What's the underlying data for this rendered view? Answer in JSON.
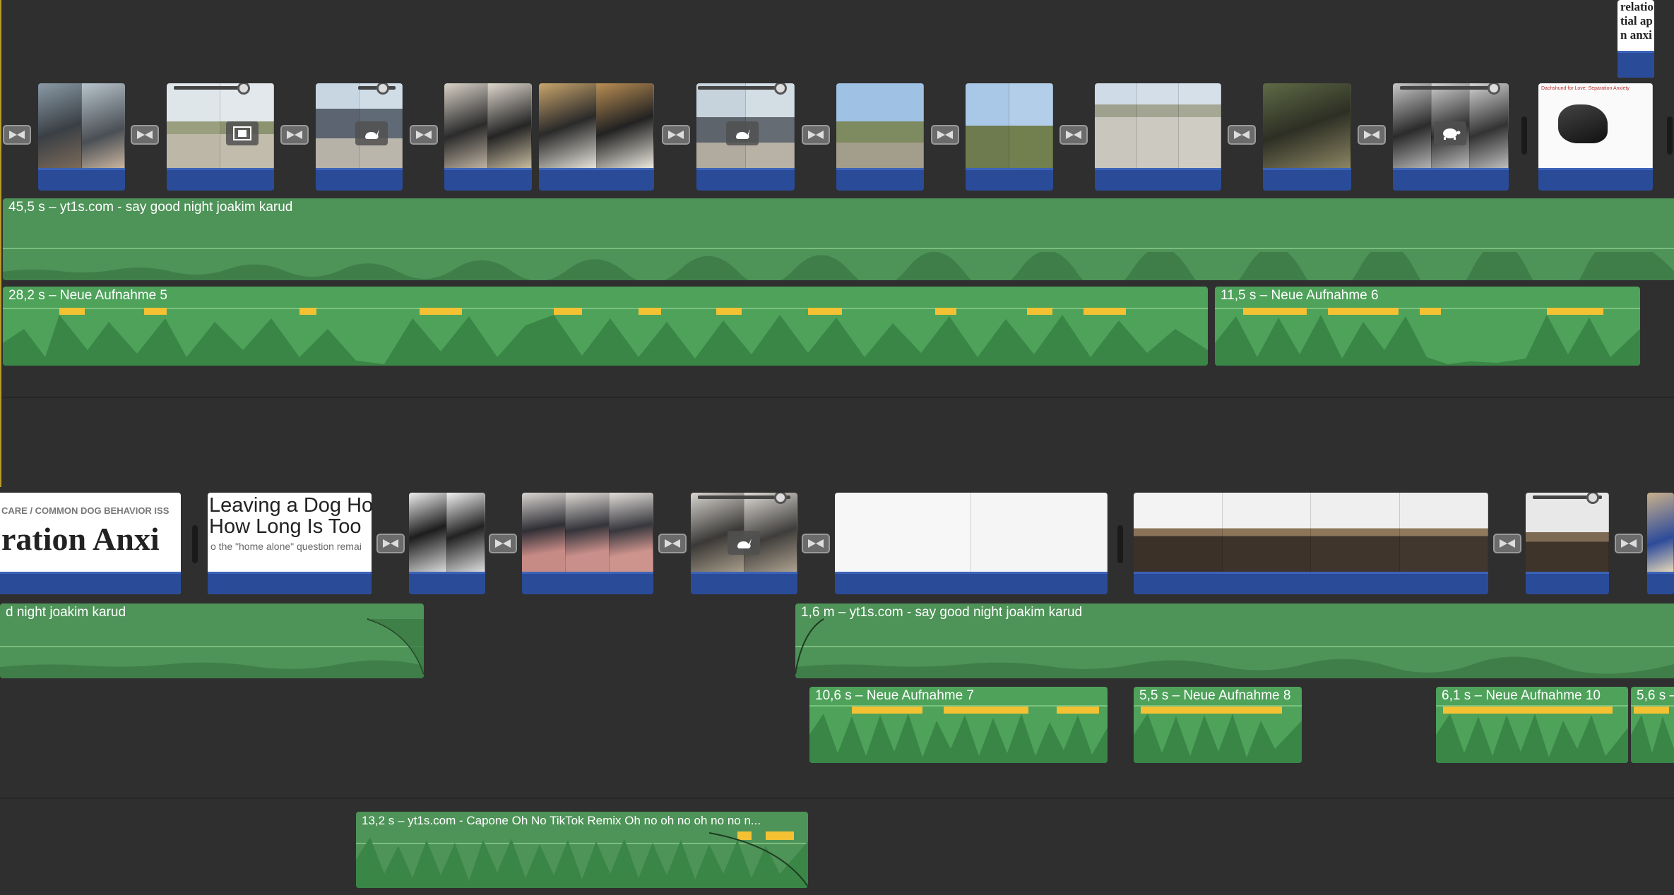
{
  "colors": {
    "background": "#2f2f2f",
    "video_bar": "#2a4b98",
    "music_clip": "#4e9358",
    "voiceover_clip": "#4ea25a",
    "peak_warning": "#f4c133",
    "playhead": "#b79a2a"
  },
  "row1": {
    "music_label": "45,5 s – yt1s.com - say good night joakim karud",
    "vo_left_label": "28,2 s – Neue Aufnahme 5",
    "vo_right_label": "11,5 s – Neue Aufnahme 6",
    "top_right_text": [
      "relatio",
      "tial ap",
      "n anxi"
    ],
    "doc_thumb_text": "Dachshund for Love: Separation Anxiety"
  },
  "row2": {
    "music_left_label": "d night joakim karud",
    "music_right_label": "1,6 m – yt1s.com - say good night joakim karud",
    "vo7_label": "10,6 s – Neue Aufnahme 7",
    "vo8_label": "5,5 s – Neue Aufnahme 8",
    "vo10_label": "6,1 s – Neue Aufnahme 10",
    "vo_last_label": "5,6 s –",
    "web_breadcrumb": "CARE / COMMON DOG BEHAVIOR ISS",
    "web_title": "ration Anxi",
    "web2_line1": "Leaving a Dog Ho",
    "web2_line2": "How Long Is Too",
    "web2_line3": "o the \"home alone\" question remai"
  },
  "row3": {
    "music_label": "13,2 s – yt1s.com - Capone  Oh No TikTok Remix  Oh no oh no oh no no n..."
  },
  "icons": {
    "transition": "transition-bowtie-icon",
    "speed_fast": "rabbit-icon",
    "speed_slow": "turtle-icon",
    "filmstrip": "filmstrip-icon"
  }
}
